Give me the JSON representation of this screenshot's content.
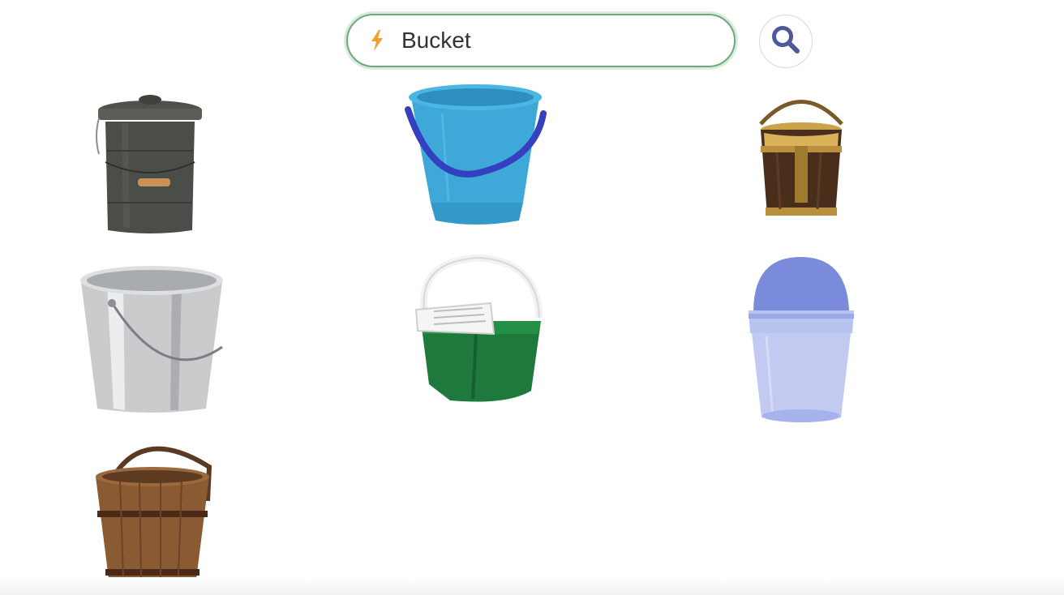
{
  "search": {
    "query": "Bucket",
    "icon": "lightning-bolt-icon",
    "button_icon": "magnifier-icon",
    "accent_color": "#6aaa7c",
    "bolt_color": "#f0a030",
    "button_icon_color": "#4d5a9a"
  },
  "results": [
    {
      "item": "metal-bin-with-lid"
    },
    {
      "item": "blue-plastic-bucket"
    },
    {
      "item": "brass-bound-wooden-bucket"
    },
    {
      "item": "stainless-steel-pail"
    },
    {
      "item": "green-mop-bucket-with-wringer"
    },
    {
      "item": "clear-plastic-bucket-with-lid"
    },
    {
      "item": "wooden-bucket"
    }
  ]
}
